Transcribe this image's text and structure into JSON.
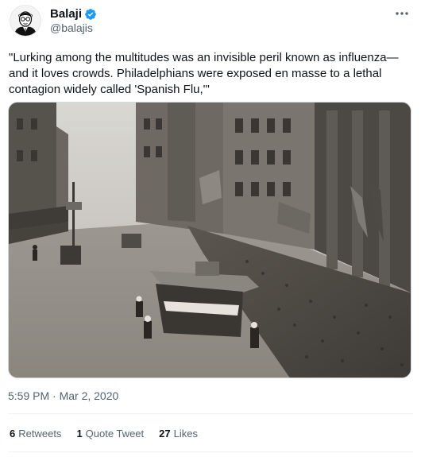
{
  "author": {
    "display_name": "Balaji",
    "handle": "@balajis",
    "verified": true
  },
  "tweet": {
    "text": "\"Lurking among the multitudes was an invisible peril known as influenza—and it loves crowds. Philadelphians were exposed en masse to a lethal contagion widely called 'Spanish Flu,'\"",
    "timestamp": "5:59 PM · Mar 2, 2020"
  },
  "stats": [
    {
      "count": "6",
      "label": "Retweets"
    },
    {
      "count": "1",
      "label": "Quote Tweet"
    },
    {
      "count": "27",
      "label": "Likes"
    }
  ],
  "icons": {
    "more": "more-options-icon",
    "verified": "verified-badge-icon"
  },
  "colors": {
    "verified_blue": "#1d9bf0",
    "secondary_text": "#536471",
    "primary_text": "#0f1419",
    "border": "#cfd9de"
  }
}
